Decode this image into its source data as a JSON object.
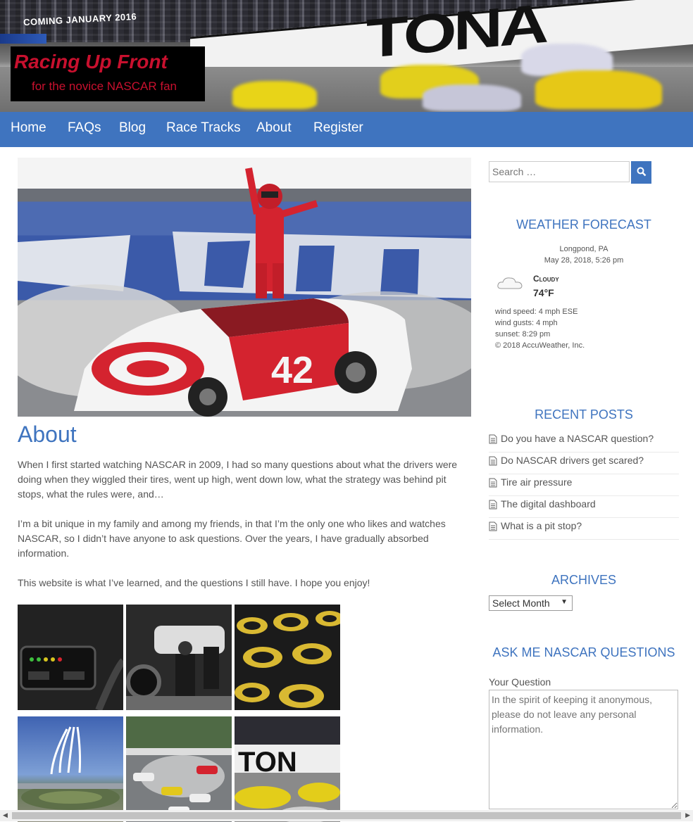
{
  "site": {
    "title": "Racing Up Front",
    "tagline": "for the novice NASCAR fan",
    "banner_text": "COMING JANUARY 2016",
    "banner_big": "TONA"
  },
  "nav": [
    "Home",
    "FAQs",
    "Blog",
    "Race Tracks",
    "About",
    "Register"
  ],
  "main": {
    "heading": "About",
    "paragraphs": [
      "When I first started watching NASCAR in 2009, I had so many questions about what the drivers were doing when they wiggled their tires, went up high, went down low, what the strategy was behind pit stops, what the rules were, and…",
      "I’m a bit unique in my family and among my friends, in that I’m the only one who likes and watches NASCAR, so I didn’t have anyone to ask questions.  Over the years, I have gradually absorbed information.",
      "This website is what I’ve learned, and the questions I still have.  I hope you enjoy!"
    ]
  },
  "sidebar": {
    "search_placeholder": "Search …",
    "weather": {
      "title": "WEATHER FORECAST",
      "location": "Longpond, PA",
      "datetime": "May 28, 2018, 5:26 pm",
      "condition": "Cloudy",
      "temp": "74°F",
      "wind_speed": "wind speed: 4 mph ESE",
      "wind_gusts": "wind gusts: 4 mph",
      "sunset": "sunset: 8:29 pm",
      "copyright": "© 2018 AccuWeather, Inc."
    },
    "recent_posts_title": "RECENT POSTS",
    "recent_posts": [
      "Do you have a NASCAR question?",
      "Do NASCAR drivers get scared?",
      "Tire air pressure",
      "The digital dashboard",
      "What is a pit stop?"
    ],
    "archives_title": "ARCHIVES",
    "archives_select": "Select Month",
    "ask_title": "ASK ME NASCAR QUESTIONS",
    "ask_label": "Your Question",
    "ask_placeholder": "In the spirit of keeping it anonymous, please do not leave any personal information."
  },
  "colors": {
    "accent": "#3f74bf",
    "logo_red": "#c8102e"
  }
}
